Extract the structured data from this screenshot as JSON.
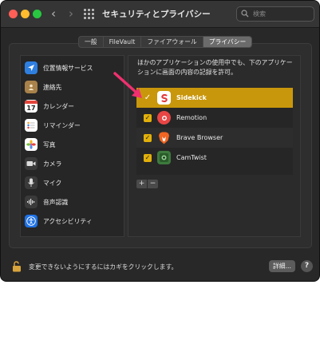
{
  "window": {
    "title": "セキュリティとプライバシー",
    "nav_back": "‹",
    "nav_forward": "›"
  },
  "search": {
    "placeholder": "検索"
  },
  "tabs": [
    {
      "label": "一般",
      "active": false
    },
    {
      "label": "FileVault",
      "active": false
    },
    {
      "label": "ファイアウォール",
      "active": false
    },
    {
      "label": "プライバシー",
      "active": true
    }
  ],
  "sidebar": {
    "items": [
      {
        "label": "位置情報サービス",
        "icon": "location-arrow-icon",
        "color": "#2f7fe0"
      },
      {
        "label": "連絡先",
        "icon": "contacts-book-icon",
        "color": "#a8824a"
      },
      {
        "label": "カレンダー",
        "icon": "calendar-icon",
        "color": "#ffffff",
        "day": "17"
      },
      {
        "label": "リマインダー",
        "icon": "reminders-icon",
        "color": "#ffffff"
      },
      {
        "label": "写真",
        "icon": "photos-flower-icon",
        "color": "#ffffff"
      },
      {
        "label": "カメラ",
        "icon": "camera-icon",
        "color": "#3a3a3a"
      },
      {
        "label": "マイク",
        "icon": "microphone-icon",
        "color": "#3a3a3a"
      },
      {
        "label": "音声認識",
        "icon": "waveform-icon",
        "color": "#3a3a3a"
      },
      {
        "label": "アクセシビリティ",
        "icon": "accessibility-icon",
        "color": "#1f72e6"
      }
    ]
  },
  "panel": {
    "description": "ほかのアプリケーションの使用中でも、下のアプリケーションに画面の内容の記録を許可。",
    "apps": [
      {
        "name": "Sidekick",
        "checked": true,
        "selected": true,
        "icon": "sidekick-app-icon",
        "color": "#ffffff"
      },
      {
        "name": "Remotion",
        "checked": true,
        "selected": false,
        "icon": "remotion-app-icon",
        "color": "#e84545"
      },
      {
        "name": "Brave Browser",
        "checked": true,
        "selected": false,
        "icon": "brave-lion-icon",
        "color": "#f26522"
      },
      {
        "name": "CamTwist",
        "checked": true,
        "selected": false,
        "icon": "camtwist-app-icon",
        "color": "#3d7a3d"
      }
    ],
    "add_label": "+",
    "remove_label": "−"
  },
  "footer": {
    "lock_text": "変更できないようにするにはカギをクリックします。",
    "advanced_label": "詳細...",
    "help_label": "?"
  },
  "accent": "#c9970b"
}
